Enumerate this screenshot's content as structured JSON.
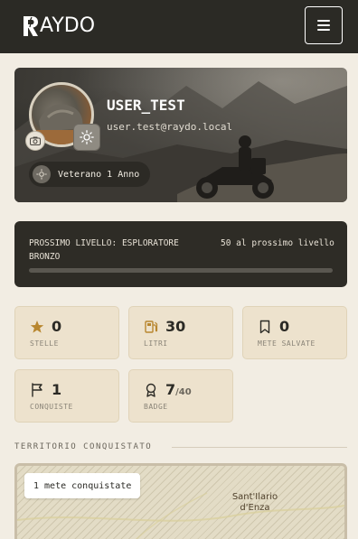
{
  "app": {
    "brand": "AYDO",
    "menu_icon": "hamburger-icon"
  },
  "profile": {
    "username": "USER_TEST",
    "email": "user.test@raydo.local",
    "badge_label": "Veterano 1 Anno"
  },
  "level": {
    "next_label": "PROSSIMO LIVELLO: ESPLORATORE BRONZO",
    "remaining": "50 al prossimo livello",
    "progress_fraction": 0.0
  },
  "stats": [
    {
      "value": "0",
      "label": "STELLE",
      "icon": "star-icon"
    },
    {
      "value": "30",
      "label": "LITRI",
      "icon": "fuel-icon"
    },
    {
      "value": "0",
      "label": "METE SALVATE",
      "icon": "bookmark-icon"
    },
    {
      "value": "1",
      "label": "CONQUISTE",
      "icon": "flag-icon"
    },
    {
      "value": "7",
      "denominator": "/40",
      "label": "BADGE",
      "icon": "medal-icon"
    }
  ],
  "territory": {
    "title": "TERRITORIO CONQUISTATO",
    "count_label": "1 mete conquistate",
    "place_name": "Sant'Ilario d'Enza"
  },
  "colors": {
    "topbar": "#2b2a25",
    "background": "#f2ede3",
    "stat_card": "#ede2cd",
    "accent": "#b8862e"
  }
}
